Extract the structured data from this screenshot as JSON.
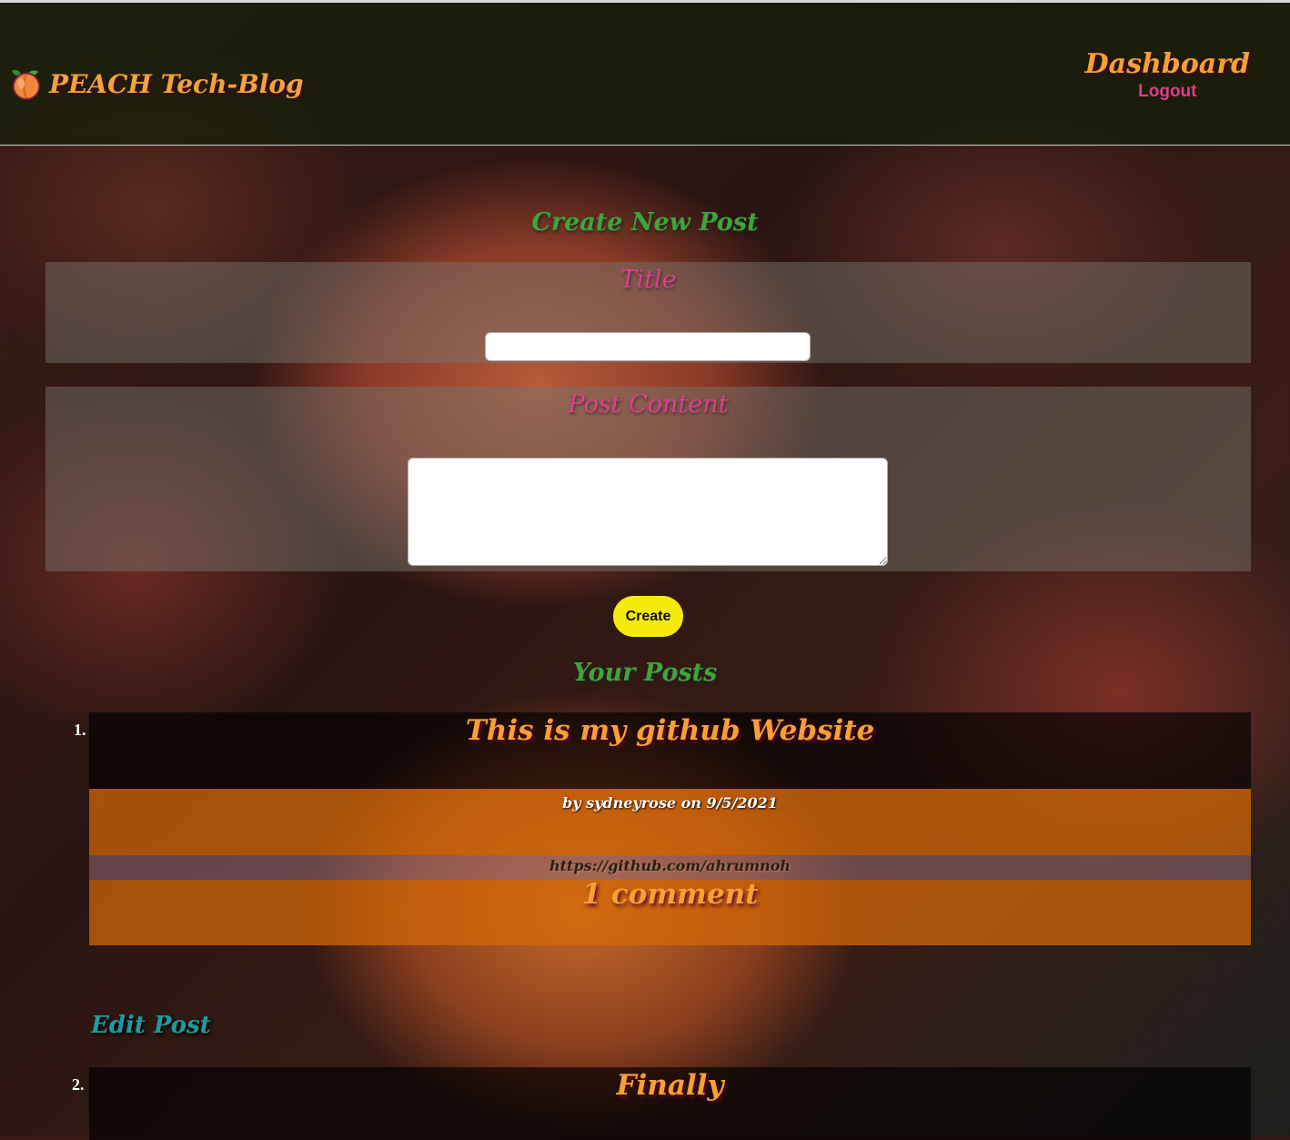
{
  "header": {
    "brand_title": "PEACH Tech-Blog",
    "brand_icon": "peach-icon",
    "nav_dashboard": "Dashboard",
    "nav_logout": "Logout"
  },
  "create_section": {
    "heading": "Create New Post",
    "title_label": "Title",
    "title_value": "",
    "content_label": "Post Content",
    "content_value": "",
    "create_button": "Create"
  },
  "posts_section": {
    "heading": "Your Posts",
    "posts": [
      {
        "number": "1.",
        "title": "This is my github Website",
        "meta": "by sydneyrose on 9/5/2021",
        "link": "https://github.com/ahrumnoh",
        "comments": "1 comment",
        "edit_label": "Edit Post"
      },
      {
        "number": "2.",
        "title": "Finally"
      }
    ]
  },
  "colors": {
    "brand_orange": "#f7a035",
    "logout_pink": "#e23b8a",
    "heading_green": "#3fa43a",
    "label_pink": "#e33d8e",
    "button_yellow": "#f6ea0c",
    "edit_teal": "#1f9ba0"
  }
}
